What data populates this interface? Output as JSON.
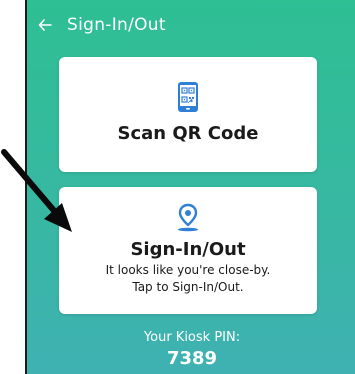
{
  "header": {
    "title": "Sign-In/Out",
    "back_icon": "arrow-left-icon"
  },
  "cards": {
    "scan": {
      "title": "Scan QR Code",
      "icon": "phone-qr-icon"
    },
    "sign": {
      "title": "Sign-In/Out",
      "line1": "It looks like you're close-by.",
      "line2": "Tap to Sign-In/Out.",
      "icon": "location-pin-icon"
    }
  },
  "kiosk": {
    "label": "Your Kiosk PIN:",
    "pin": "7389"
  },
  "colors": {
    "accent": "#2f7fd6",
    "gradient_top": "#2ebf93",
    "gradient_bottom": "#3fb1b2"
  }
}
